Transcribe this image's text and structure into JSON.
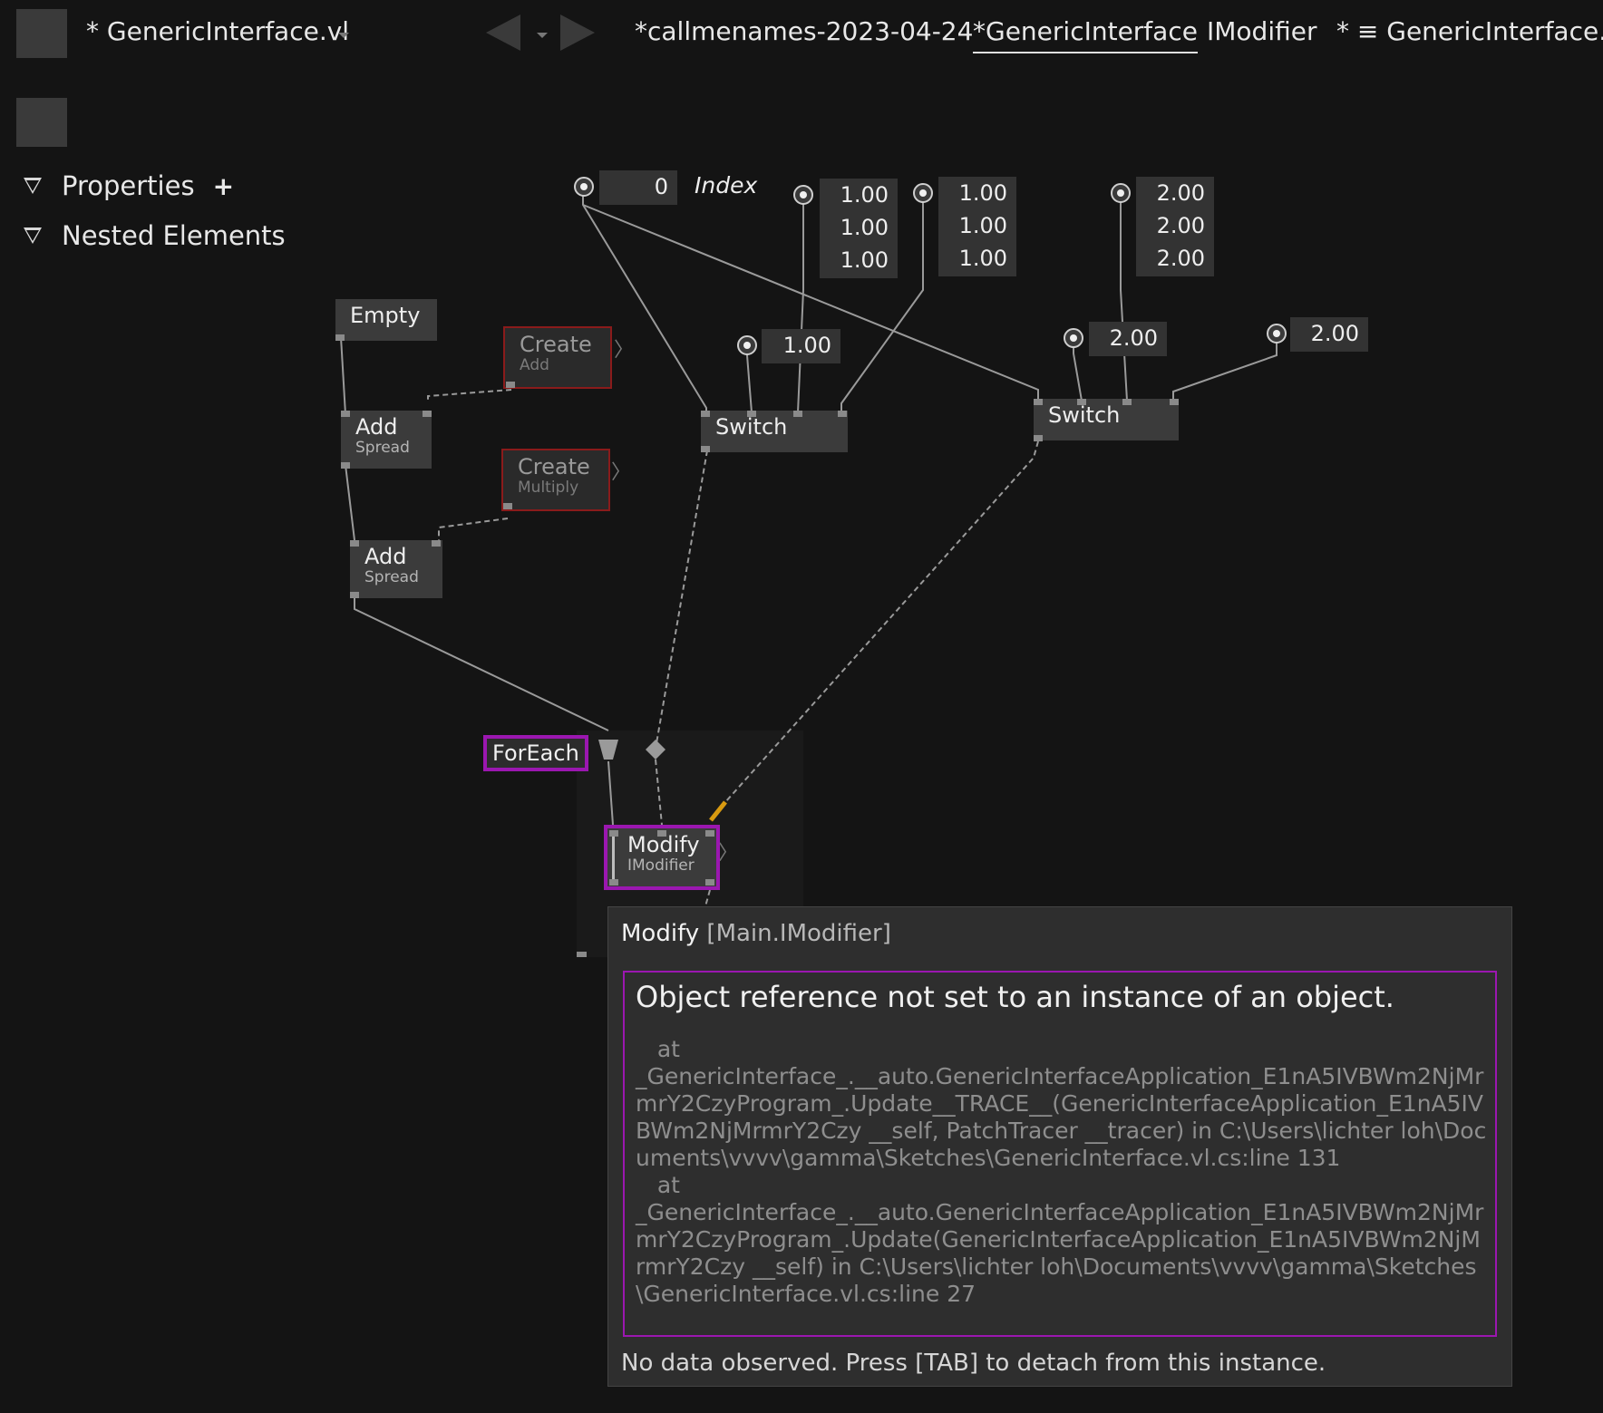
{
  "topbar": {
    "doc_name": "* GenericInterface.vl",
    "tabs": [
      "*callmenames-2023-04-24",
      "*GenericInterface",
      "IModifier",
      "* ≡ GenericInterface.vl"
    ]
  },
  "sidebar": {
    "properties_label": "Properties",
    "add_glyph": "+",
    "nested_label": "Nested Elements"
  },
  "patch": {
    "index_value": "0",
    "index_label": "Index",
    "spread_a": [
      "1.00",
      "1.00",
      "1.00"
    ],
    "spread_b": [
      "1.00",
      "1.00",
      "1.00"
    ],
    "spread_c": [
      "2.00",
      "2.00",
      "2.00"
    ],
    "switch1_input": "1.00",
    "switch2_input": "2.00",
    "switch2_input_b": "2.00",
    "empty_node": "Empty",
    "create_add": {
      "title": "Create",
      "sub": "Add"
    },
    "create_multiply": {
      "title": "Create",
      "sub": "Multiply"
    },
    "add_spread_1": {
      "title": "Add",
      "sub": "Spread"
    },
    "add_spread_2": {
      "title": "Add",
      "sub": "Spread"
    },
    "switch1": "Switch",
    "switch2": "Switch",
    "foreach_label": "ForEach",
    "modify_node": {
      "title": "Modify",
      "sub": "IModifier"
    }
  },
  "tooltip": {
    "title": "Modify",
    "type": "[Main.IModifier]",
    "error_message": "Object reference not set to an instance of an object.",
    "stack_trace": "   at\n_GenericInterface_.__auto.GenericInterfaceApplication_E1nA5IVBWm2NjMrmrY2CzyProgram_.Update__TRACE__(GenericInterfaceApplication_E1nA5IVBWm2NjMrmrY2Czy __self, PatchTracer __tracer) in C:\\Users\\lichter loh\\Documents\\vvvv\\gamma\\Sketches\\GenericInterface.vl.cs:line 131\n   at\n_GenericInterface_.__auto.GenericInterfaceApplication_E1nA5IVBWm2NjMrmrY2CzyProgram_.Update(GenericInterfaceApplication_E1nA5IVBWm2NjMrmrY2Czy __self) in C:\\Users\\lichter loh\\Documents\\vvvv\\gamma\\Sketches\\GenericInterface.vl.cs:line 27",
    "footer": "No data observed. Press [TAB] to detach from this instance."
  },
  "colors": {
    "background": "#141414",
    "selection_highlight": "#9b17b0",
    "error_node_border": "#8a1b1b",
    "warning_link": "#d89a10"
  }
}
